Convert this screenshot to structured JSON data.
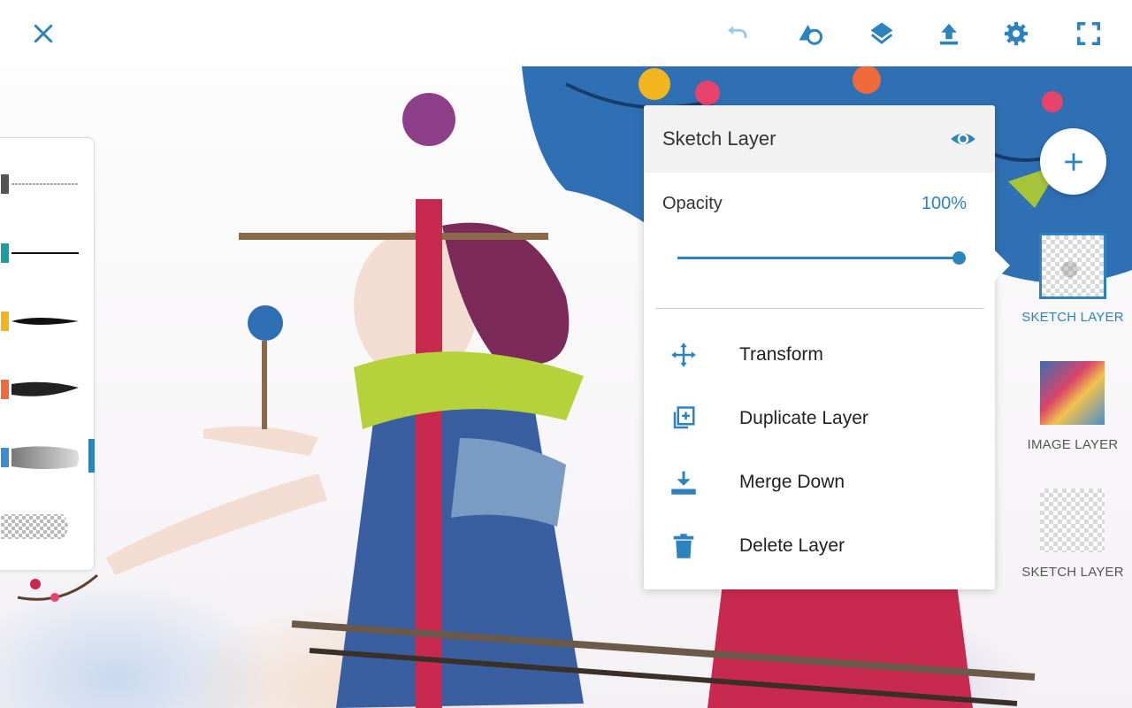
{
  "colors": {
    "accent": "#2d83be",
    "toolbar_icon": "#2d83be",
    "undo_disabled": "#9ecbe8"
  },
  "toolbar": {
    "icons": [
      "close-icon",
      "undo-icon",
      "shape-icon",
      "layers-icon",
      "upload-icon",
      "settings-icon",
      "fullscreen-icon"
    ]
  },
  "brushes": [
    {
      "name": "pencil",
      "color": "#555555"
    },
    {
      "name": "ink-pen",
      "color": "#1a9e9e"
    },
    {
      "name": "brush-pen",
      "color": "#f2b51e"
    },
    {
      "name": "paint-brush",
      "color": "#f06a3c"
    },
    {
      "name": "soft-airbrush",
      "color": "#3a8fd0",
      "selected": true
    },
    {
      "name": "eraser",
      "color": "#cccccc"
    }
  ],
  "layer_panel": {
    "title": "Sketch Layer",
    "opacity_label": "Opacity",
    "opacity_value": "100%",
    "opacity": 1.0,
    "actions": [
      {
        "label": "Transform",
        "icon": "move-icon"
      },
      {
        "label": "Duplicate Layer",
        "icon": "duplicate-icon"
      },
      {
        "label": "Merge Down",
        "icon": "merge-down-icon"
      },
      {
        "label": "Delete Layer",
        "icon": "trash-icon"
      }
    ]
  },
  "layers": [
    {
      "label": "SKETCH LAYER",
      "type": "sketch",
      "selected": true
    },
    {
      "label": "IMAGE LAYER",
      "type": "image",
      "selected": false
    },
    {
      "label": "SKETCH LAYER",
      "type": "sketch",
      "selected": false
    }
  ]
}
